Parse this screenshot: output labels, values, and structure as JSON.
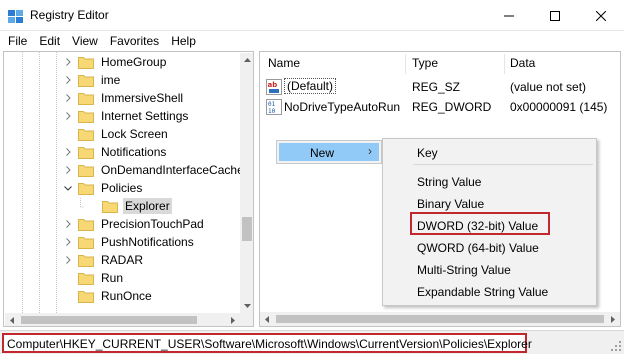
{
  "window": {
    "title": "Registry Editor"
  },
  "menu": [
    "File",
    "Edit",
    "View",
    "Favorites",
    "Help"
  ],
  "tree": {
    "items": [
      {
        "label": "HomeGroup",
        "expander": "right"
      },
      {
        "label": "ime",
        "expander": "right"
      },
      {
        "label": "ImmersiveShell",
        "expander": "right"
      },
      {
        "label": "Internet Settings",
        "expander": "right"
      },
      {
        "label": "Lock Screen",
        "expander": "none"
      },
      {
        "label": "Notifications",
        "expander": "right"
      },
      {
        "label": "OnDemandInterfaceCache",
        "expander": "right"
      },
      {
        "label": "Policies",
        "expander": "down"
      },
      {
        "label": "Explorer",
        "expander": "none",
        "selected": true
      },
      {
        "label": "PrecisionTouchPad",
        "expander": "right"
      },
      {
        "label": "PushNotifications",
        "expander": "right"
      },
      {
        "label": "RADAR",
        "expander": "right"
      },
      {
        "label": "Run",
        "expander": "none"
      },
      {
        "label": "RunOnce",
        "expander": "none"
      }
    ]
  },
  "list": {
    "columns": {
      "name": "Name",
      "type": "Type",
      "data": "Data"
    },
    "rows": [
      {
        "name": "(Default)",
        "type": "REG_SZ",
        "data": "(value not set)",
        "icon": "string-value-icon"
      },
      {
        "name": "NoDriveTypeAutoRun",
        "type": "REG_DWORD",
        "data": "0x00000091 (145)",
        "icon": "dword-value-icon"
      }
    ]
  },
  "context_menu": {
    "new_label": "New",
    "submenu": [
      "Key",
      "String Value",
      "Binary Value",
      "DWORD (32-bit) Value",
      "QWORD (64-bit) Value",
      "Multi-String Value",
      "Expandable String Value"
    ]
  },
  "status": {
    "path": "Computer\\HKEY_CURRENT_USER\\Software\\Microsoft\\Windows\\CurrentVersion\\Policies\\Explorer"
  },
  "colors": {
    "highlight": "#91c9f7",
    "annotation": "#c1272d",
    "folder": "#f8d775"
  }
}
